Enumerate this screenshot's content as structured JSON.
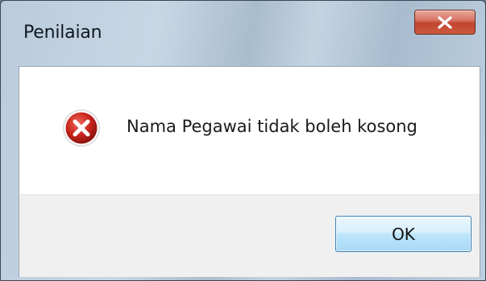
{
  "window": {
    "title": "Penilaian"
  },
  "title_bar": {
    "close_icon": "close-icon"
  },
  "dialog": {
    "icon": "error-icon",
    "message": "Nama Pegawai tidak boleh kosong",
    "ok_label": "OK"
  },
  "colors": {
    "close_button": "#c7503a",
    "error_icon": "#c8231a",
    "ok_button_border": "#3c7fb1",
    "button_area": "#f0f0f0"
  }
}
